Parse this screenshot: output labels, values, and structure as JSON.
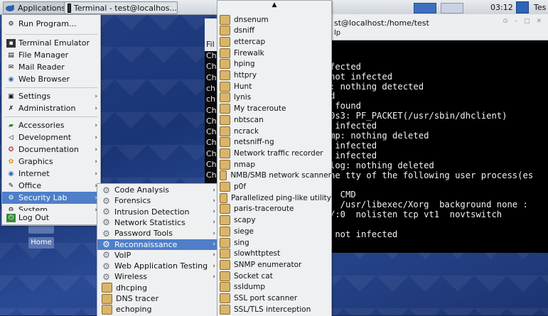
{
  "panel": {
    "applications_label": "Applications",
    "task_label": "Terminal - test@localhos...",
    "clock": "03:12",
    "right_label": "Tes"
  },
  "desktop": {
    "icons": [
      "Home"
    ]
  },
  "terminal": {
    "title": "st@localhost:/home/test",
    "menu_fragment": "lp",
    "lines": [
      "fected",
      "not infected",
      ": nothing detected",
      "d",
      " found",
      "0s3: PF_PACKET(/usr/sbin/dhclient)",
      " infected",
      "mp: nothing deleted",
      " infected",
      " infected",
      "log: nothing deleted",
      "he tty of the following user process(es",
      "",
      "  CMD",
      "  /usr/libexec/Xorg  background none :",
      "/:0  nolisten tcp vt1  novtswitch",
      "",
      " not infected"
    ]
  },
  "terminal2": {
    "menu_fragment": "Fil",
    "lines": [
      "Ch",
      "Ch",
      "Ch",
      "ch",
      "ch",
      "Ch",
      "Ch",
      "Ch",
      "Ch",
      "Ch",
      "Ch",
      "Ch",
      "Ch"
    ]
  },
  "app_menu": {
    "items": [
      {
        "label": "Run Program...",
        "icon": "run-icon"
      },
      {
        "label": "Terminal Emulator",
        "icon": "terminal-icon"
      },
      {
        "label": "File Manager",
        "icon": "folder-icon"
      },
      {
        "label": "Mail Reader",
        "icon": "mail-icon"
      },
      {
        "label": "Web Browser",
        "icon": "globe-icon"
      },
      {
        "label": "Settings",
        "icon": "settings-icon"
      },
      {
        "label": "Administration",
        "icon": "tools-icon"
      },
      {
        "label": "Accessories",
        "icon": "accessories-icon"
      },
      {
        "label": "Development",
        "icon": "development-icon"
      },
      {
        "label": "Documentation",
        "icon": "help-icon"
      },
      {
        "label": "Graphics",
        "icon": "graphics-icon"
      },
      {
        "label": "Internet",
        "icon": "internet-icon"
      },
      {
        "label": "Office",
        "icon": "office-icon"
      },
      {
        "label": "Security Lab",
        "icon": "gear-icon"
      },
      {
        "label": "System",
        "icon": "gear-icon"
      },
      {
        "label": "Log Out",
        "icon": "logout-icon"
      }
    ]
  },
  "security_menu": {
    "items": [
      "Code Analysis",
      "Forensics",
      "Intrusion Detection",
      "Network Statistics",
      "Password Tools",
      "Reconnaissance",
      "VoIP",
      "Web Application Testing",
      "Wireless",
      "dhcping",
      "DNS tracer",
      "echoping"
    ]
  },
  "recon_menu": {
    "scroll_up": "▲",
    "items": [
      "dnsenum",
      "dsniff",
      "ettercap",
      "Firewalk",
      "hping",
      "httpry",
      "Hunt",
      "lynis",
      "My traceroute",
      "nbtscan",
      "ncrack",
      "netsniff-ng",
      "Network traffic recorder",
      "nmap",
      "NMB/SMB network scanner",
      "p0f",
      "Parallelized ping-like utility",
      "paris-traceroute",
      "scapy",
      "siege",
      "sing",
      "slowhttptest",
      "SNMP enumerator",
      "Socket cat",
      "ssldump",
      "SSL port scanner",
      "SSL/TLS interception"
    ]
  },
  "colors": {
    "selection": "#4e7fc8",
    "menu_bg": "#eef0f2"
  }
}
